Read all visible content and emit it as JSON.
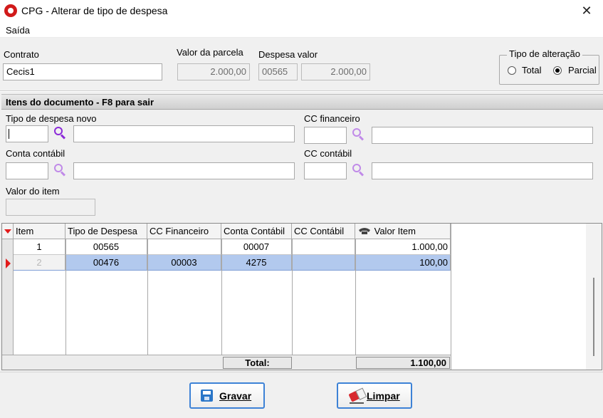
{
  "window": {
    "title": "CPG - Alterar de tipo de despesa",
    "close_glyph": "✕"
  },
  "menu": {
    "items": [
      "Saída"
    ]
  },
  "header": {
    "contrato_label": "Contrato",
    "contrato_value": "Cecis1",
    "valor_parcela_label": "Valor da parcela",
    "valor_parcela_value": "2.000,00",
    "despesa_valor_label": "Despesa valor",
    "despesa_code": "00565",
    "despesa_valor_value": "2.000,00"
  },
  "tipo_alteracao": {
    "title": "Tipo de alteração",
    "options": [
      "Total",
      "Parcial"
    ],
    "selected": "Parcial"
  },
  "section": {
    "title": "Itens do documento   -  F8 para sair"
  },
  "form": {
    "tipo_despesa_label": "Tipo de despesa novo",
    "cc_financeiro_label": "CC financeiro",
    "conta_contabil_label": "Conta contábil",
    "cc_contabil_label": "CC contábil",
    "valor_item_label": "Valor do item"
  },
  "grid": {
    "columns": [
      "Item",
      "Tipo de Despesa",
      "CC Financeiro",
      "Conta Contábil",
      "CC Contábil",
      "Valor Item"
    ],
    "rows": [
      {
        "item": "1",
        "tipo": "00565",
        "ccf": "",
        "conta": "00007",
        "ccc": "",
        "valor": "1.000,00"
      },
      {
        "item": "2",
        "tipo": "00476",
        "ccf": "00003",
        "conta": "4275",
        "ccc": "",
        "valor": "100,00"
      }
    ],
    "selected_row": 1,
    "total_label": "Total:",
    "total_value": "1.100,00"
  },
  "buttons": {
    "save": "Gravar",
    "clear": "Limpar"
  },
  "icons": {
    "app": "app-logo-icon",
    "search": "search-icon",
    "save": "save-icon",
    "clear": "eraser-icon",
    "phone": "telephone-icon",
    "sort": "sort-down-icon",
    "row_pointer": "row-pointer-icon"
  },
  "colors": {
    "accent": "#3d82d6",
    "selection": "#b2c9ee",
    "search_icon": "#8b2bd8",
    "app_icon": "#d11a1a"
  }
}
